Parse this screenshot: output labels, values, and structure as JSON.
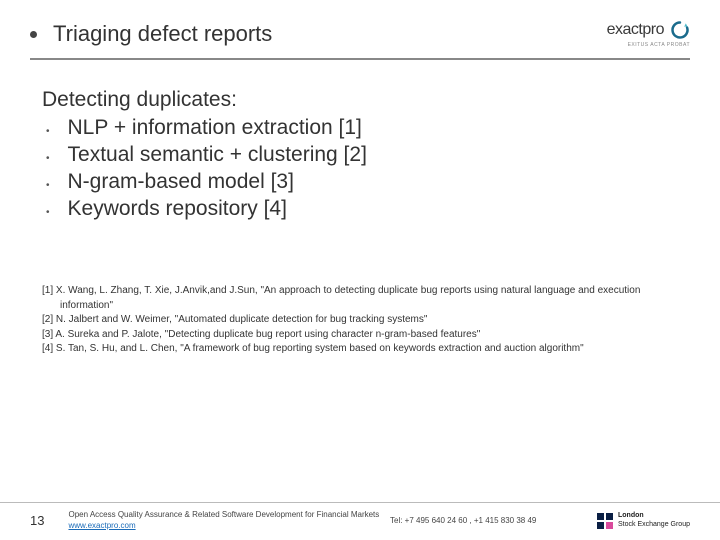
{
  "header": {
    "title": "Triaging defect reports",
    "logo_text": "exactpro",
    "logo_sub": "EXITUS ACTA PROBAT"
  },
  "content": {
    "heading": "Detecting duplicates:",
    "items": [
      "NLP + information extraction [1]",
      "Textual semantic + clustering [2]",
      "N-gram-based model [3]",
      "Keywords repository [4]"
    ]
  },
  "refs": [
    "[1]  X. Wang, L. Zhang, T. Xie, J.Anvik,and J.Sun, \"An approach to detecting duplicate bug reports using natural language and execution information\"",
    "[2]  N. Jalbert and W. Weimer, \"Automated duplicate detection for bug tracking systems\"",
    "[3] A. Sureka and P. Jalote, \"Detecting duplicate bug report using character n-gram-based features\"",
    "[4] S. Tan, S. Hu, and L. Chen, \"A framework of bug reporting system based on keywords extraction and auction algorithm\""
  ],
  "footer": {
    "page": "13",
    "line1": "Open Access Quality Assurance & Related Software Development for Financial Markets",
    "link": "www.exactpro.com",
    "tel": "Tel: +7 495 640 24 60 ,  +1 415 830 38 49",
    "lse1": "London",
    "lse2": "Stock Exchange Group"
  }
}
